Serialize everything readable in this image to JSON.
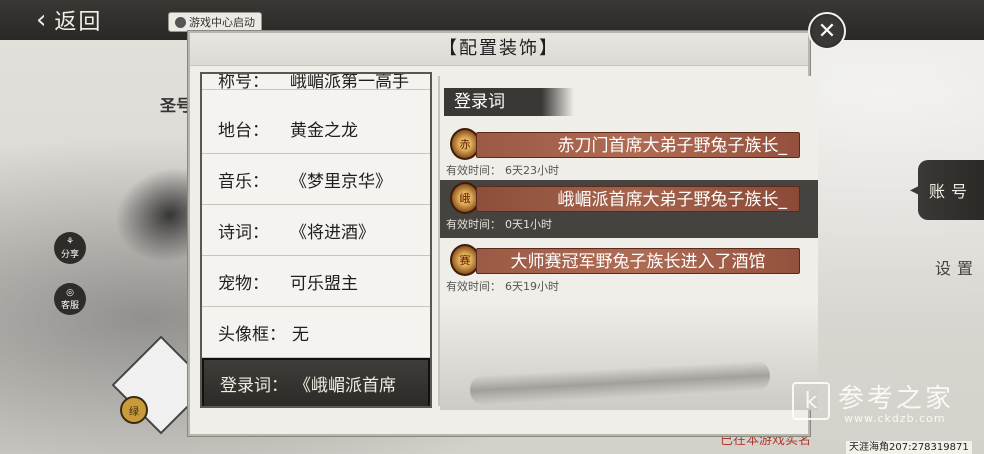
{
  "header": {
    "back_label": "返回",
    "game_center_label": "游戏中心启动"
  },
  "background": {
    "left_fragment": "圣号",
    "share_label": "分享",
    "kefu_label": "客服",
    "avatar_badge": "绿"
  },
  "right_tabs": {
    "account": "账号",
    "settings": "设置"
  },
  "footer": {
    "realname": "已在本游戏实名",
    "id_tag": "天涯海角207:278319871"
  },
  "watermark": {
    "logo": "k",
    "title": "参考之家",
    "url": "www.ckdzb.com"
  },
  "dialog": {
    "title": "【配置装饰】",
    "left_list": [
      {
        "key": "称号：",
        "value": "峨嵋派第一高手"
      },
      {
        "key": "地台：",
        "value": "黄金之龙"
      },
      {
        "key": "音乐：",
        "value": "《梦里京华》"
      },
      {
        "key": "诗词：",
        "value": "《将进酒》"
      },
      {
        "key": "宠物：",
        "value": "可乐盟主"
      },
      {
        "key": "头像框：",
        "value": "无"
      },
      {
        "key": "登录词：",
        "value": "《峨嵋派首席"
      }
    ],
    "section_title": "登录词",
    "entries": [
      {
        "medal": "赤",
        "text": "赤刀门首席大弟子野兔子族长_",
        "validity_label": "有效时间：",
        "validity_value": "6天23小时"
      },
      {
        "medal": "峨",
        "text": "峨嵋派首席大弟子野兔子族长_",
        "validity_label": "有效时间：",
        "validity_value": "0天1小时"
      },
      {
        "medal": "赛",
        "text": "大师赛冠军野兔子族长进入了酒馆",
        "validity_label": "有效时间：",
        "validity_value": "6天19小时"
      }
    ]
  }
}
